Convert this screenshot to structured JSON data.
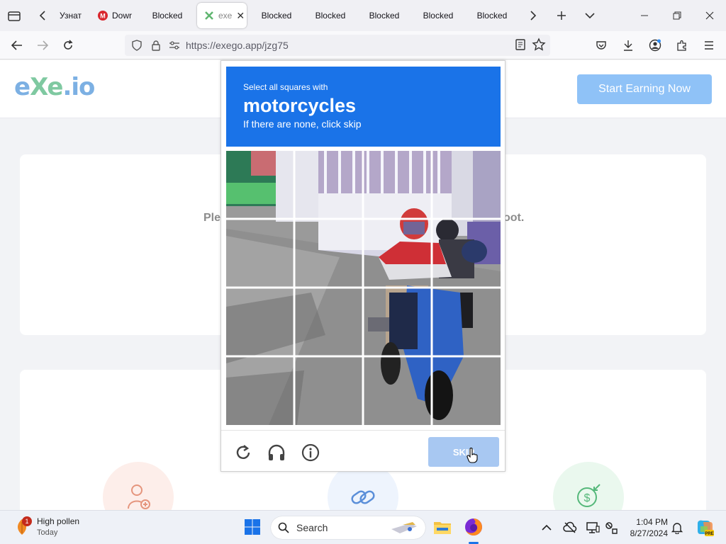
{
  "browser": {
    "tabs": [
      {
        "label": "Узнат",
        "favicon": "globe-icon"
      },
      {
        "label": "Dowr",
        "favicon": "mega-icon"
      },
      {
        "label": "Blocked",
        "favicon": ""
      },
      {
        "label": "exe",
        "favicon": "exe-icon",
        "active": true
      },
      {
        "label": "Blocked",
        "favicon": ""
      },
      {
        "label": "Blocked",
        "favicon": ""
      },
      {
        "label": "Blocked",
        "favicon": ""
      },
      {
        "label": "Blocked",
        "favicon": ""
      },
      {
        "label": "Blocked",
        "favicon": ""
      }
    ],
    "url": "https://exego.app/jzg75"
  },
  "site": {
    "logo_part1": "e",
    "logo_part2": "Xe",
    "logo_part3": ".io",
    "cta_label": "Start Earning Now",
    "card_text_left": "Ple",
    "card_text_right": "oot."
  },
  "captcha": {
    "prompt_line1": "Select all squares with",
    "prompt_object": "motorcycles",
    "prompt_line3": "If there are none, click skip",
    "skip_label": "SKIP",
    "grid_rows": 4,
    "grid_cols": 4
  },
  "taskbar": {
    "weather_title": "High pollen",
    "weather_sub": "Today",
    "weather_badge": "1",
    "search_placeholder": "Search",
    "time": "1:04 PM",
    "date": "8/27/2024"
  },
  "colors": {
    "captcha_header": "#1a73e8",
    "cta": "#8fc2f7",
    "skip": "#a8c8f2"
  }
}
